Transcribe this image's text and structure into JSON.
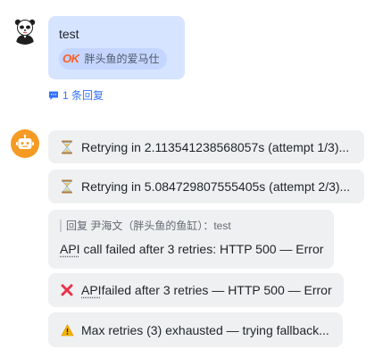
{
  "user_message": {
    "text": "test",
    "ref_tag": {
      "logo": "OK",
      "label": "胖头鱼的爱马仕"
    }
  },
  "reply_link": {
    "text": "1 条回复"
  },
  "bot_messages": [
    {
      "icon": "hourglass-icon",
      "text": "Retrying in 2.113541238568057s (attempt 1/3)..."
    },
    {
      "icon": "hourglass-icon",
      "text": "Retrying in 5.084729807555405s (attempt 2/3)..."
    },
    {
      "quote": "回复 尹海文（胖头鱼的鱼缸）：test",
      "text_underlined": "API",
      "text_rest": " call failed after 3 retries: HTTP 500 — Error"
    },
    {
      "icon": "cross-mark-icon",
      "text_underlined": "API",
      "text_rest": " failed after 3 retries — HTTP 500 — Error"
    },
    {
      "icon": "warning-icon",
      "text": "Max retries (3) exhausted — trying fallback..."
    }
  ],
  "colors": {
    "user_bubble": "#d6e4ff",
    "bot_bubble": "#eff0f1",
    "link": "#3370ff",
    "bot_avatar": "#f59a23"
  }
}
